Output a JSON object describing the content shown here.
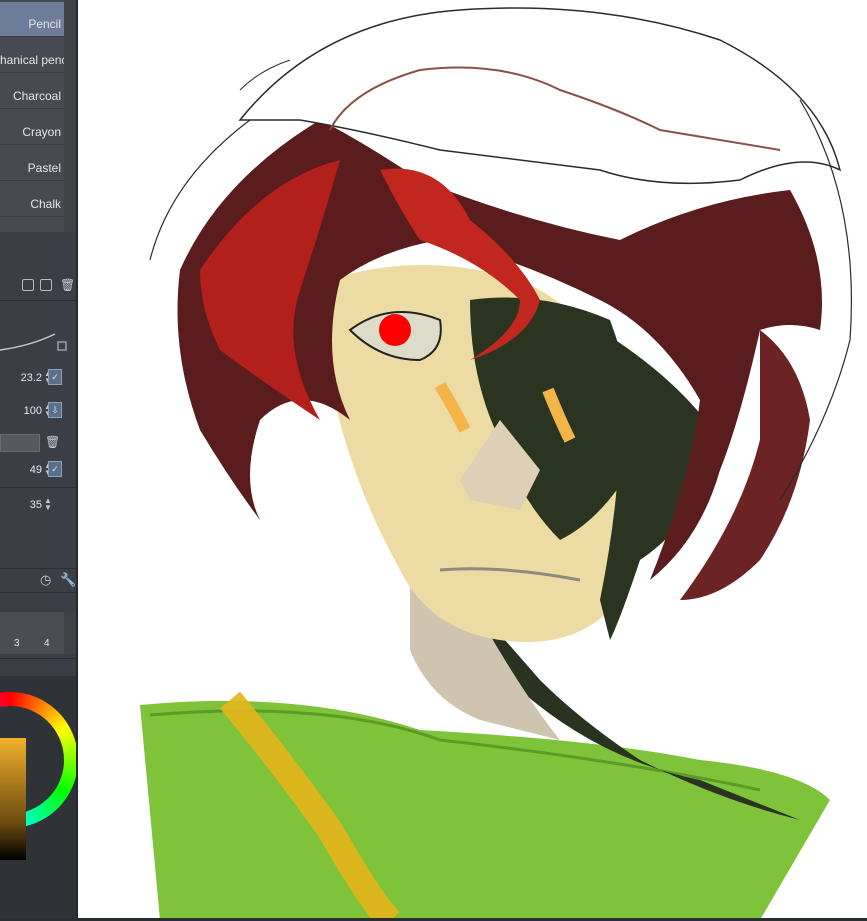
{
  "brushes": {
    "items": [
      {
        "label": "Pencil",
        "selected": true
      },
      {
        "label": "hanical pencil",
        "selected": false
      },
      {
        "label": "Charcoal",
        "selected": false
      },
      {
        "label": "Crayon",
        "selected": false
      },
      {
        "label": "Pastel",
        "selected": false
      },
      {
        "label": "Chalk",
        "selected": false
      }
    ]
  },
  "tool_property": {
    "brush_size": "23.2",
    "opacity": "100",
    "param_a": "49",
    "param_b": "35"
  },
  "sub_view": {
    "numbers": [
      "3",
      "4"
    ]
  },
  "icons": {
    "add_brush": "add-brush-icon",
    "duplicate_brush": "duplicate-brush-icon",
    "delete_brush": "trash-icon",
    "settings": "wrench-icon"
  },
  "colors": {
    "current_color": "#f1b12b",
    "selection": "#6d7d99",
    "panel_bg": "#3b3f45"
  }
}
